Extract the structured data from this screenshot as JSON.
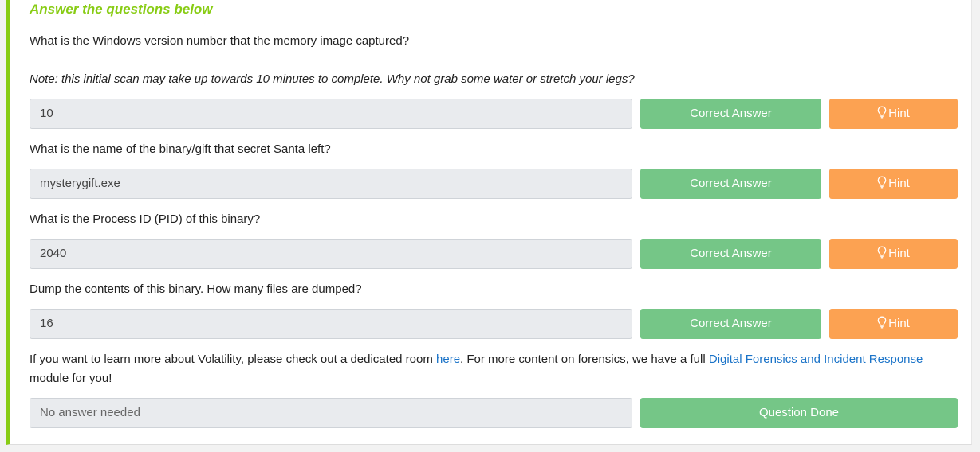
{
  "section": {
    "title": "Answer the questions below"
  },
  "questions": [
    {
      "text": "What is the Windows version number that the memory image captured?",
      "note": "Note: this initial scan may take up towards 10 minutes to complete. Why not grab some water or stretch your legs?",
      "answer": "10",
      "correct_label": "Correct Answer",
      "hint_label": "Hint"
    },
    {
      "text": "What is the name of the binary/gift that secret Santa left?",
      "answer": "mysterygift.exe",
      "correct_label": "Correct Answer",
      "hint_label": "Hint"
    },
    {
      "text": "What is the Process ID (PID) of this binary?",
      "answer": "2040",
      "correct_label": "Correct Answer",
      "hint_label": "Hint"
    },
    {
      "text": "Dump the contents of this binary. How many files are dumped?",
      "answer": "16",
      "correct_label": "Correct Answer",
      "hint_label": "Hint"
    }
  ],
  "final": {
    "text_part1": "If you want to learn more about Volatility, please check out a dedicated room ",
    "link1": "here",
    "text_part2": ". For more content on forensics, we have a full ",
    "link2": "Digital Forensics and Incident Response",
    "text_part3": " module for you!",
    "answer": "No answer needed",
    "done_label": "Question Done"
  },
  "colors": {
    "accent": "#88cc14",
    "correct_button": "#75c687",
    "hint_button": "#fca252",
    "link": "#1a73c8"
  },
  "icons": {
    "hint": "lightbulb-icon"
  }
}
